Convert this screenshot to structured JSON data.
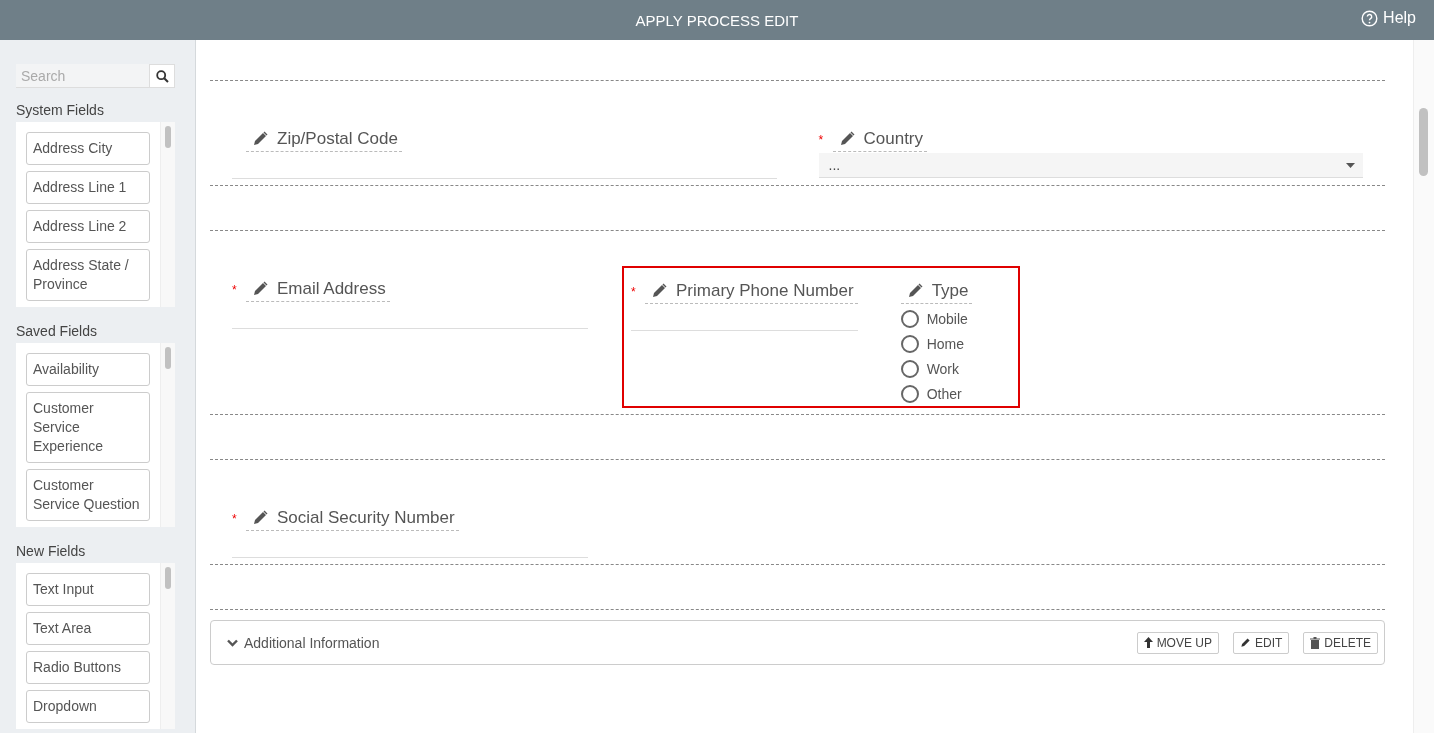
{
  "header": {
    "title": "APPLY PROCESS EDIT",
    "help": "Help"
  },
  "sidebar": {
    "search": {
      "placeholder": "Search"
    },
    "sections": [
      {
        "title": "System Fields",
        "items": [
          "Address City",
          "Address Line 1",
          "Address Line 2",
          "Address State / Province"
        ]
      },
      {
        "title": "Saved Fields",
        "items": [
          "Availability",
          "Customer Service Experience",
          "Customer Service Question"
        ]
      },
      {
        "title": "New Fields",
        "items": [
          "Text Input",
          "Text Area",
          "Radio Buttons",
          "Dropdown"
        ]
      }
    ]
  },
  "form": {
    "rows": [
      {
        "fields": [
          {
            "kind": "text",
            "label": "Zip/Postal Code"
          },
          {
            "kind": "select",
            "label": "Country",
            "required_mark": "*",
            "value": "..."
          }
        ]
      },
      {
        "fields": [
          {
            "kind": "text",
            "label": "Email Address",
            "required_mark": "*"
          },
          {
            "kind": "group",
            "selected": true,
            "fields": [
              {
                "kind": "text",
                "label": "Primary Phone Number",
                "required_mark": "*"
              },
              {
                "kind": "radio",
                "label": "Type",
                "options": [
                  {
                    "label": "Mobile",
                    "checked": false
                  },
                  {
                    "label": "Home",
                    "checked": false
                  },
                  {
                    "label": "Work",
                    "checked": false
                  },
                  {
                    "label": "Other",
                    "checked": false
                  }
                ]
              }
            ]
          }
        ]
      },
      {
        "fields": [
          {
            "kind": "text",
            "label": "Social Security Number",
            "required_mark": "*"
          }
        ]
      }
    ],
    "section": {
      "title": "Additional Information",
      "expanded": false,
      "buttons": [
        {
          "kind": "up",
          "label": "MOVE UP"
        },
        {
          "kind": "edit",
          "label": "EDIT"
        },
        {
          "kind": "delete",
          "label": "DELETE"
        }
      ]
    }
  }
}
